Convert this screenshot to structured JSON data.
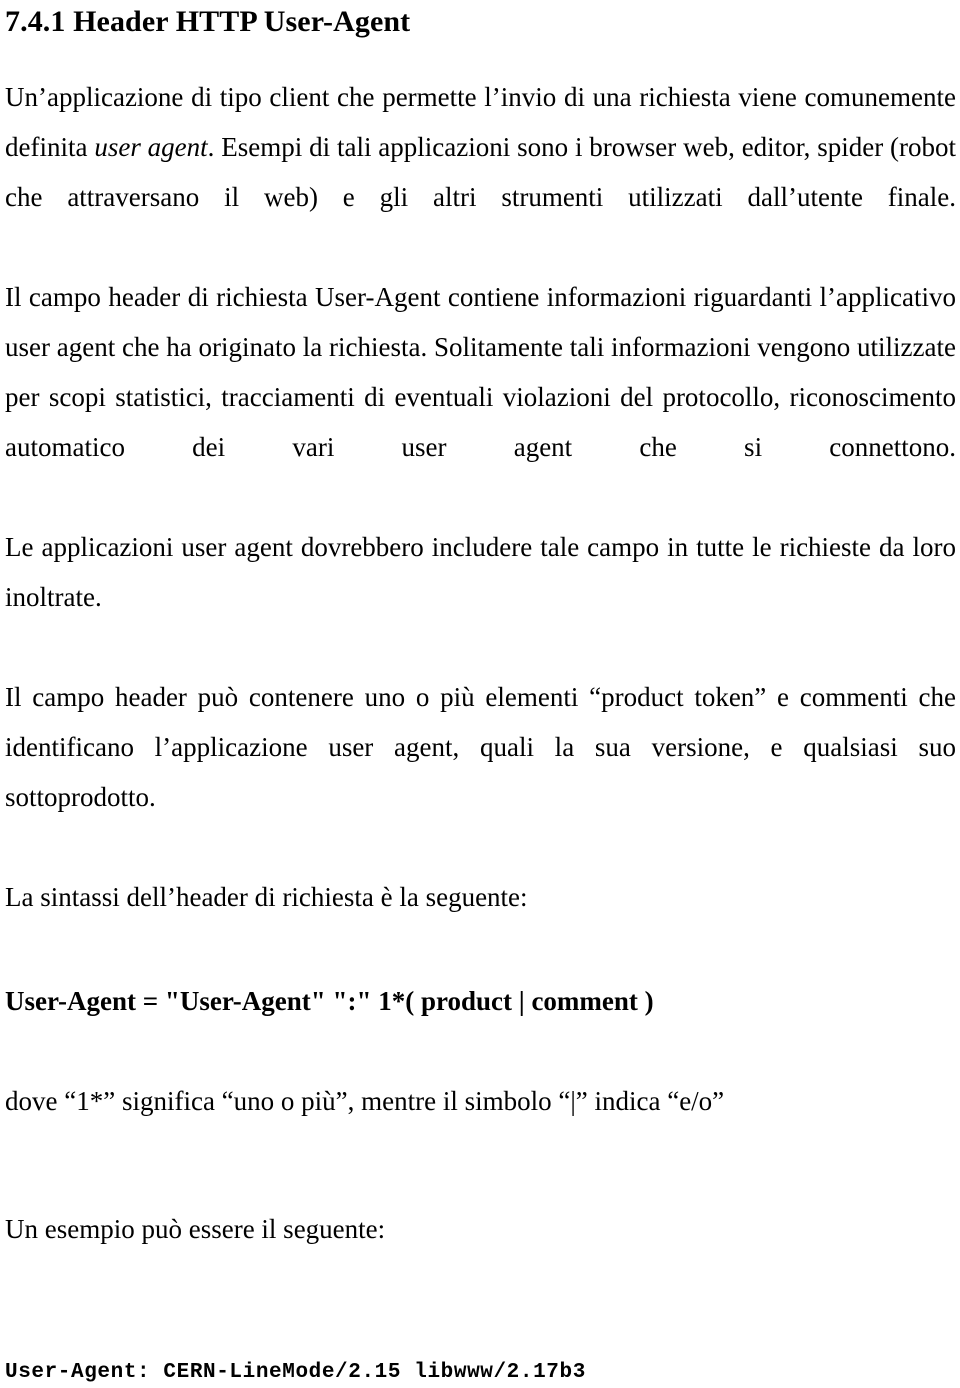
{
  "document": {
    "heading": "7.4.1 Header HTTP User-Agent",
    "language": "it",
    "paragraphs": {
      "p1_part1": "Un’applicazione di tipo client che permette l’invio di una richiesta viene comunemente definita ",
      "p1_italic": "user agent",
      "p1_part2": ". Esempi di tali applicazioni sono i browser web, editor, spider (robot che attraversano il web) e gli altri strumenti utilizzati dall’utente finale.",
      "p2": "Il campo header di richiesta User-Agent contiene informazioni riguardanti l’applicativo user agent che ha originato la richiesta. Solitamente tali informazioni vengono utilizzate per scopi statistici, tracciamenti di eventuali violazioni del protocollo, riconoscimento automatico dei vari user agent che si connettono.",
      "p3": "Le applicazioni user agent dovrebbero includere tale campo in tutte le richieste da loro inoltrate.",
      "p4": "Il campo header può contenere uno o più elementi “product token” e commenti che identificano l’applicazione user agent, quali la sua versione, e qualsiasi suo sottoprodotto.",
      "p5": "La sintassi dell’header di richiesta è la seguente:",
      "p6": "dove “1*” significa “uno o più”, mentre il simbolo “|” indica “e/o”",
      "p7": "Un esempio può essere il seguente:"
    },
    "code": {
      "syntax_definition": "User-Agent = \"User-Agent\" \":\" 1*( product | comment )",
      "example_header": "User-Agent: CERN-LineMode/2.15 libwww/2.17b3"
    },
    "colors": {
      "text": "#000000",
      "background": "#ffffff"
    }
  }
}
